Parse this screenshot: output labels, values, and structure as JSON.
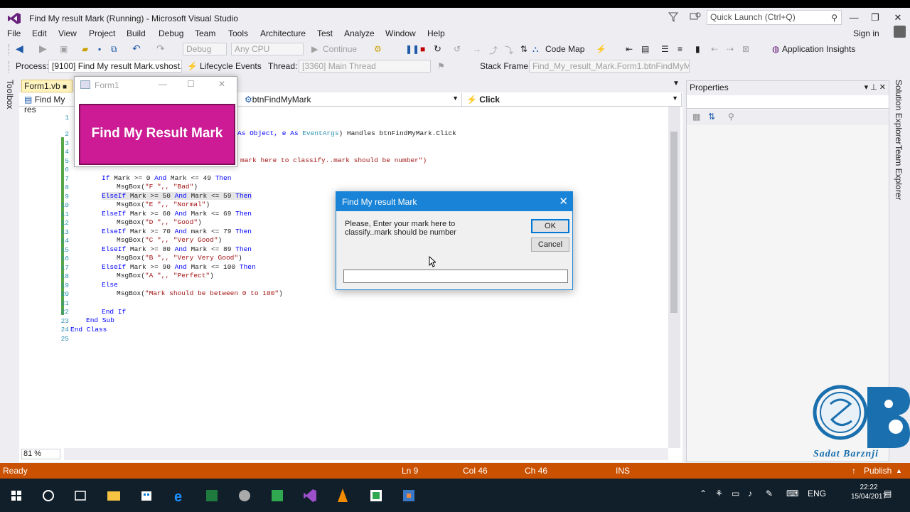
{
  "window": {
    "title": "Find My result Mark (Running) - Microsoft Visual Studio"
  },
  "quick_launch": {
    "placeholder": "Quick Launch (Ctrl+Q)"
  },
  "menu": [
    "File",
    "Edit",
    "View",
    "Project",
    "Build",
    "Debug",
    "Team",
    "Tools",
    "Architecture",
    "Test",
    "Analyze",
    "Window",
    "Help"
  ],
  "account": {
    "signin": "Sign in"
  },
  "toolbar1": {
    "config": "Debug",
    "platform": "Any CPU",
    "continue": "Continue",
    "codemap": "Code Map",
    "insights": "Application Insights"
  },
  "toolbar2": {
    "process_label": "Process:",
    "process": "[9100] Find My result Mark.vshost.",
    "lifecycle": "Lifecycle Events",
    "thread_label": "Thread:",
    "thread": "[3360] Main Thread",
    "stackframe_label": "Stack Frame:",
    "stackframe": "Find_My_result_Mark.Form1.btnFindMyM"
  },
  "toolbox": {
    "label": "Toolbox"
  },
  "doc_tab": {
    "label": "Form1.vb"
  },
  "nav": {
    "left": "Find My res",
    "middle": "btnFindMyMark",
    "right": "Click"
  },
  "code": {
    "line_numbers": [
      "1",
      "2",
      "3",
      "4",
      "5",
      "6",
      "7",
      "8",
      "9",
      "10",
      "11",
      "12",
      "13",
      "14",
      "15",
      "16",
      "17",
      "18",
      "19",
      "20",
      "21",
      "22",
      "23",
      "24",
      "25"
    ],
    "l2_a": "As Object, e As ",
    "l2_b": "EventArgs",
    "l2_c": ") Handles btnFindMyMark.Click",
    "l5": "mark here to classify..mark should be number\")",
    "l7_kw1": "If",
    "l7_mid": " Mark >= 0 ",
    "l7_and": "And",
    "l7_mid2": " Mark <= 49 ",
    "l7_then": "Then",
    "l8_a": "MsgBox(",
    "l8_s": "\"F \",, \"Bad\"",
    "l8_c": ")",
    "l9_kw": "ElseIf",
    "l9_mid": " Mark >= 50 ",
    "l9_mid2": " Mark <= 59 ",
    "l10_s": "\"E \",, \"Normal\"",
    "l11_mid": " Mark >= 60 ",
    "l11_mid2": " Mark <= 69 ",
    "l12_s": "\"D \",, \"Good\"",
    "l13_mid": " Mark >= 70 ",
    "l13_mid2": " mark <= 79 ",
    "l14_s": "\"C \",, \"Very Good\"",
    "l15_mid": " Mark >= 80 ",
    "l15_mid2": " Mark <= 89 ",
    "l16_s": "\"B \",, \"Very Very Good\"",
    "l17_mid": " Mark >= 90 ",
    "l17_mid2": " Mark <= 100 ",
    "l18_s": "\"A \",, \"Perfect\"",
    "l19": "Else",
    "l20_s": "\"Mark should be between 0 to 100\"",
    "l22": "End If",
    "l23": "End Sub",
    "l24": "End Class"
  },
  "zoom": "81 %",
  "properties": {
    "title": "Properties"
  },
  "right_tabs": {
    "solution_explorer": "Solution Explorer",
    "team_explorer": "Team Explorer"
  },
  "form1": {
    "title": "Form1",
    "button": "Find My Result Mark"
  },
  "dialog": {
    "title": "Find My result Mark",
    "message": "Please, Enter your mark here to classify..mark should be number",
    "ok": "OK",
    "cancel": "Cancel",
    "input_value": ""
  },
  "status": {
    "state": "Ready",
    "line": "Ln 9",
    "col": "Col 46",
    "ch": "Ch 46",
    "mode": "INS",
    "publish": "Publish"
  },
  "tray": {
    "lang": "ENG",
    "time": "22:22",
    "date": "15/04/2017"
  },
  "watermark": {
    "text": "Sadat Barznji"
  },
  "colors": {
    "accent": "#1883d7",
    "status": "#ca5100",
    "button": "#cc1b94"
  }
}
